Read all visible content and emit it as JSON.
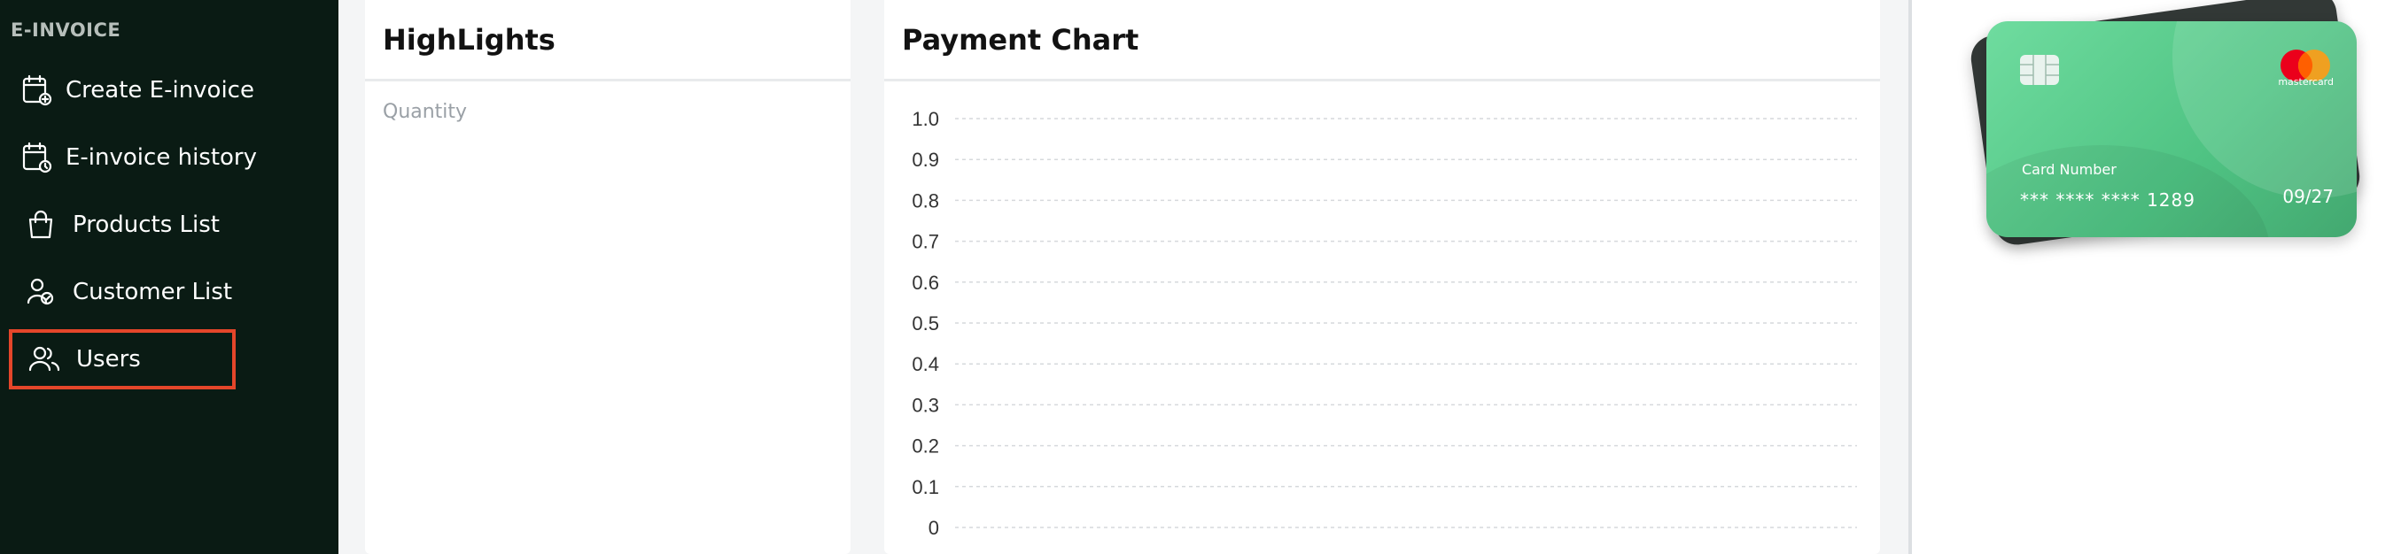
{
  "sidebar": {
    "section_title": "E-INVOICE",
    "items": [
      {
        "label": "Create E-invoice",
        "icon": "calendar-add-icon"
      },
      {
        "label": "E-invoice history",
        "icon": "calendar-clock-icon"
      },
      {
        "label": "Products List",
        "icon": "shopping-bag-icon"
      },
      {
        "label": "Customer List",
        "icon": "customers-icon"
      },
      {
        "label": "Users",
        "icon": "users-icon",
        "highlighted": true
      }
    ]
  },
  "highlights": {
    "title": "HighLights",
    "subtitle": "Quantity"
  },
  "payment_chart": {
    "title": "Payment Chart"
  },
  "chart_data": {
    "type": "line",
    "title": "Payment Chart",
    "xlabel": "",
    "ylabel": "",
    "ylim": [
      0,
      1
    ],
    "y_ticks": [
      "1.0",
      "0.9",
      "0.8",
      "0.7",
      "0.6",
      "0.5",
      "0.4",
      "0.3",
      "0.2",
      "0.1",
      "0"
    ],
    "series": [],
    "grid": true
  },
  "card": {
    "brand": "mastercard",
    "number_label": "Card Number",
    "number": "*** **** **** 1289",
    "expiry": "09/27"
  },
  "colors": {
    "sidebar_bg": "#0a1b14",
    "highlight_border": "#e5462a",
    "card_green": "#4fc383",
    "card_back": "#323836"
  }
}
